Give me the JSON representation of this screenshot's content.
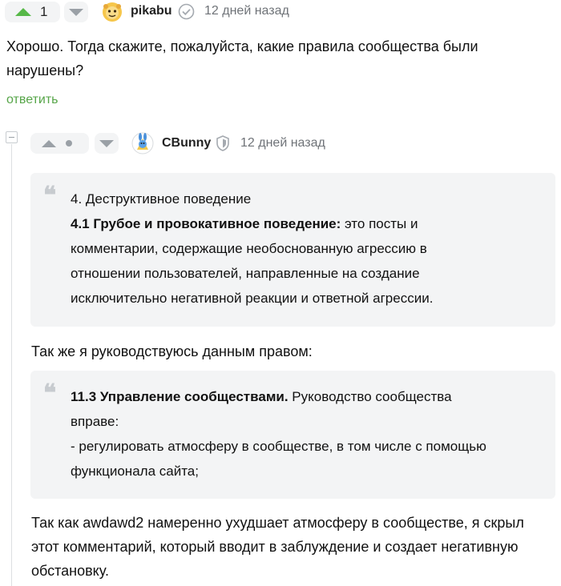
{
  "comment1": {
    "rating": "1",
    "username": "pikabu",
    "time": "12 дней назад",
    "text_line1": "Хорошо. Тогда скажите, пожалуйста, какие правила сообщества были",
    "text_line2": "нарушены?",
    "reply_label": "ответить"
  },
  "comment2": {
    "username": "CBunny",
    "time": "12 дней назад",
    "quote1": {
      "heading": "4. Деструктивное поведение",
      "bold": "4.1 Грубое и провокативное поведение:",
      "line1_rest": " это посты и",
      "line2": "комментарии, содержащие необоснованную агрессию в",
      "line3": "отношении пользователей, направленные на создание",
      "line4": "исключительно негативной реакции и ответной агрессии."
    },
    "intro": "Так же я руководствуюсь данным правом:",
    "quote2": {
      "bold": "11.3 Управление сообществами.",
      "line1_rest": " Руководство сообщества",
      "line2": "вправе:",
      "line3": "- регулировать атмосферу в сообществе, в том числе с помощью",
      "line4": "функционала сайта;"
    },
    "conclusion_line1": "Так как awdawd2 намеренно ухудшает атмосферу в сообществе, я скрыл",
    "conclusion_line2": "этот комментарий, который вводит в заблуждение и создает негативную",
    "conclusion_line3": "обстановку."
  },
  "colors": {
    "accent_green": "#57b848",
    "reply_green": "#56a548",
    "muted": "#6f7378",
    "quote_bg": "#f3f4f5"
  }
}
